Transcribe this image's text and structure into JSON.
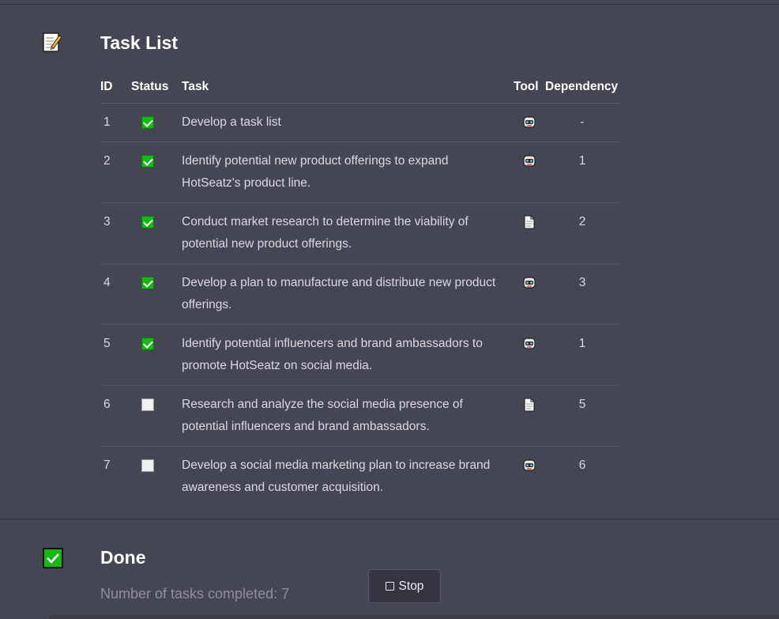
{
  "task_list": {
    "icon": "notepad-icon",
    "title": "Task List",
    "columns": {
      "id": "ID",
      "status": "Status",
      "task": "Task",
      "tool": "Tool",
      "dependency": "Dependency"
    },
    "rows": [
      {
        "id": "1",
        "status": "done",
        "task": "Develop a task list",
        "tool": "robot-icon",
        "dependency": "-"
      },
      {
        "id": "2",
        "status": "done",
        "task": "Identify potential new product offerings to expand HotSeatz's product line.",
        "tool": "robot-icon",
        "dependency": "1"
      },
      {
        "id": "3",
        "status": "done",
        "task": "Conduct market research to determine the viability of potential new product offerings.",
        "tool": "document-icon",
        "dependency": "2"
      },
      {
        "id": "4",
        "status": "done",
        "task": "Develop a plan to manufacture and distribute new product offerings.",
        "tool": "robot-icon",
        "dependency": "3"
      },
      {
        "id": "5",
        "status": "done",
        "task": "Identify potential influencers and brand ambassadors to promote HotSeatz on social media.",
        "tool": "robot-icon",
        "dependency": "1"
      },
      {
        "id": "6",
        "status": "todo",
        "task": "Research and analyze the social media presence of potential influencers and brand ambassadors.",
        "tool": "document-icon",
        "dependency": "5"
      },
      {
        "id": "7",
        "status": "todo",
        "task": "Develop a social media marketing plan to increase brand awareness and customer acquisition.",
        "tool": "robot-icon",
        "dependency": "6"
      }
    ]
  },
  "done_section": {
    "icon": "checkmark-box-icon",
    "title": "Done",
    "subtitle": "Number of tasks completed: 7"
  },
  "stop_button": {
    "label": "Stop",
    "icon": "stop-square-icon"
  },
  "colors": {
    "background": "#444654",
    "check_green": "#15b815",
    "text": "#d9d9e3"
  }
}
